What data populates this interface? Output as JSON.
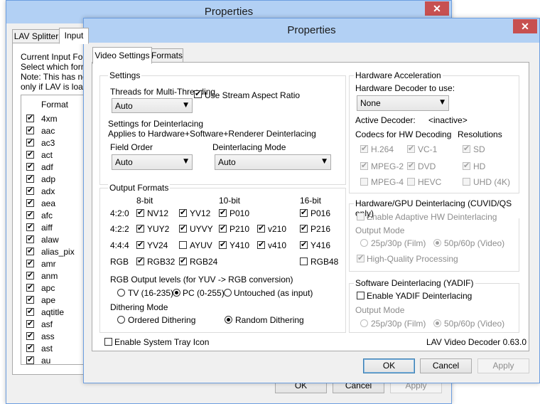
{
  "back_window": {
    "title": "Properties",
    "close_glyph": "✕",
    "tabs": [
      "LAV Splitter",
      "Input"
    ],
    "info_lines": [
      "Current Input Form",
      "Select which forma",
      "Note: This has no",
      "only if LAV is loade"
    ],
    "list_header": "Format",
    "formats": [
      "4xm",
      "aac",
      "ac3",
      "act",
      "adf",
      "adp",
      "adx",
      "aea",
      "afc",
      "aiff",
      "alaw",
      "alias_pix",
      "amr",
      "anm",
      "apc",
      "ape",
      "aqtitle",
      "asf",
      "ass",
      "ast",
      "au"
    ],
    "buttons": {
      "ok": "OK",
      "cancel": "Cancel",
      "apply": "Apply"
    }
  },
  "window": {
    "title": "Properties",
    "close_glyph": "✕",
    "tabs": {
      "video_settings": "Video Settings",
      "formats": "Formats"
    },
    "settings": {
      "group_title": "Settings",
      "threads_label": "Threads for Multi-Threading",
      "threads_value": "Auto",
      "stream_aspect_label": "Use Stream Aspect Ratio",
      "deint_title": "Settings for Deinterlacing",
      "deint_sub": "Applies to Hardware+Software+Renderer Deinterlacing",
      "field_order_label": "Field Order",
      "field_order_value": "Auto",
      "deint_mode_label": "Deinterlacing Mode",
      "deint_mode_value": "Auto"
    },
    "output_formats": {
      "group_title": "Output Formats",
      "col_8bit": "8-bit",
      "col_10bit": "10-bit",
      "col_16bit": "16-bit",
      "row_420": "4:2:0",
      "row_422": "4:2:2",
      "row_444": "4:4:4",
      "row_rgb": "RGB",
      "nv12": "NV12",
      "yv12": "YV12",
      "p010": "P010",
      "p016": "P016",
      "yuy2": "YUY2",
      "uyvy": "UYVY",
      "p210": "P210",
      "v210": "v210",
      "p216": "P216",
      "yv24": "YV24",
      "ayuv": "AYUV",
      "y410": "Y410",
      "v410": "v410",
      "y416": "Y416",
      "rgb32": "RGB32",
      "rgb24": "RGB24",
      "rgb48": "RGB48",
      "levels_label": "RGB Output levels (for YUV -> RGB conversion)",
      "tv": "TV (16-235)",
      "pc": "PC (0-255)",
      "untouched": "Untouched (as input)",
      "dither_label": "Dithering Mode",
      "ordered": "Ordered Dithering",
      "random": "Random Dithering"
    },
    "hw": {
      "group_title": "Hardware Acceleration",
      "decoder_label": "Hardware Decoder to use:",
      "decoder_value": "None",
      "active_label": "Active Decoder:",
      "active_value": "<inactive>",
      "codecs_label": "Codecs for HW Decoding",
      "res_label": "Resolutions",
      "h264": "H.264",
      "vc1": "VC-1",
      "mpeg2": "MPEG-2",
      "dvd": "DVD",
      "mpeg4": "MPEG-4",
      "hevc": "HEVC",
      "sd": "SD",
      "hd": "HD",
      "uhd": "UHD (4K)"
    },
    "hwdeint": {
      "group_title": "Hardware/GPU Deinterlacing (CUVID/QS only)",
      "adaptive": "Enable Adaptive HW Deinterlacing",
      "output_mode": "Output Mode",
      "film": "25p/30p (Film)",
      "video": "50p/60p (Video)",
      "hq": "High-Quality Processing"
    },
    "swdeint": {
      "group_title": "Software Deinterlacing (YADIF)",
      "yadif": "Enable YADIF Deinterlacing",
      "output_mode": "Output Mode",
      "film": "25p/30p (Film)",
      "video": "50p/60p (Video)"
    },
    "tray_label": "Enable System Tray Icon",
    "version": "LAV Video Decoder 0.63.0",
    "buttons": {
      "ok": "OK",
      "cancel": "Cancel",
      "apply": "Apply"
    }
  }
}
